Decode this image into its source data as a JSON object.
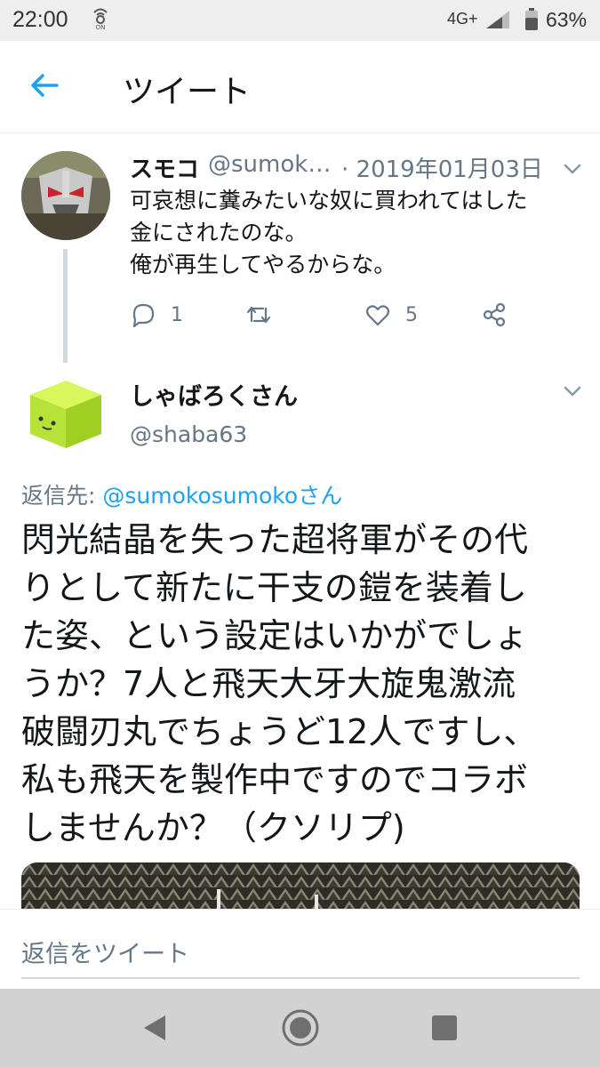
{
  "status_bar": {
    "time": "22:00",
    "network": "4G+",
    "battery": "63%"
  },
  "header": {
    "title": "ツイート"
  },
  "parent_tweet": {
    "name": "スモコ",
    "handle": "@sumok…",
    "date": "· 2019年01月03日",
    "text": "可哀想に糞みたいな奴に買われてはした\n金にされたのな。\n俺が再生してやるからな。",
    "reply_count": "1",
    "like_count": "5"
  },
  "reply_tweet": {
    "name": "しゃばろくさん",
    "handle": "@shaba63",
    "replying_prefix": "返信先: ",
    "replying_mention": "@sumokosumoko",
    "replying_suffix": "さん",
    "text": "閃光結晶を失った超将軍がその代\nりとして新たに干支の鎧を装着し\nた姿、という設定はいかがでしょ\nうか？7人と飛天大牙大旋鬼激流\n破闘刃丸でちょうど12人ですし、\n私も飛天を製作中ですのでコラボ\nしませんか？（クソリプ)"
  },
  "reply_bar": {
    "placeholder": "返信をツイート"
  },
  "colors": {
    "accent": "#1da1f2",
    "secondary_text": "#657786",
    "divider": "#e6ecf0"
  },
  "icons": [
    "back-arrow-icon",
    "chevron-down-icon",
    "reply-icon",
    "retweet-icon",
    "like-icon",
    "share-icon",
    "nav-back-icon",
    "nav-home-icon",
    "nav-recents-icon"
  ]
}
